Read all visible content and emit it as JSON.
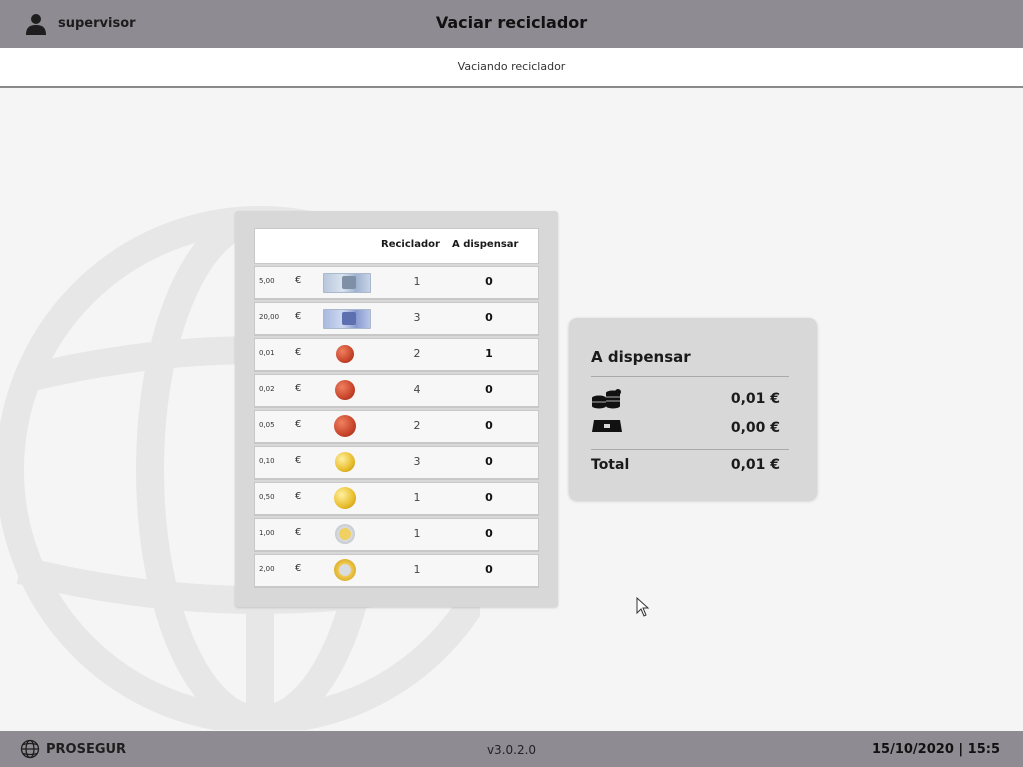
{
  "header": {
    "user": "supervisor",
    "title": "Vaciar reciclador",
    "subtitle": "Vaciando reciclador"
  },
  "table": {
    "col_recycler": "Reciclador",
    "col_dispense": "A dispensar",
    "rows": [
      {
        "denom": "5,00",
        "currency": "€",
        "type": "banknote-5-icon",
        "recycler": "1",
        "dispense": "0"
      },
      {
        "denom": "20,00",
        "currency": "€",
        "type": "banknote-20-icon",
        "recycler": "3",
        "dispense": "0"
      },
      {
        "denom": "0,01",
        "currency": "€",
        "type": "coin-copper-icon",
        "recycler": "2",
        "dispense": "1"
      },
      {
        "denom": "0,02",
        "currency": "€",
        "type": "coin-copper-icon",
        "recycler": "4",
        "dispense": "0"
      },
      {
        "denom": "0,05",
        "currency": "€",
        "type": "coin-copper-icon",
        "recycler": "2",
        "dispense": "0"
      },
      {
        "denom": "0,10",
        "currency": "€",
        "type": "coin-gold-icon",
        "recycler": "3",
        "dispense": "0"
      },
      {
        "denom": "0,50",
        "currency": "€",
        "type": "coin-gold-icon",
        "recycler": "1",
        "dispense": "0"
      },
      {
        "denom": "1,00",
        "currency": "€",
        "type": "coin-bimetal-icon",
        "recycler": "1",
        "dispense": "0"
      },
      {
        "denom": "2,00",
        "currency": "€",
        "type": "coin-bimetal-icon",
        "recycler": "1",
        "dispense": "0"
      }
    ]
  },
  "summary": {
    "title": "A dispensar",
    "coins_value": "0,01 €",
    "notes_value": "0,00 €",
    "total_label": "Total",
    "total_value": "0,01 €"
  },
  "footer": {
    "brand": "PROSEGUR",
    "version": "v3.0.2.0",
    "datetime": "15/10/2020 | 15:5"
  },
  "colors": {
    "bar": "#8e8b92",
    "panel": "#d8d8d8",
    "background": "#f5f5f5"
  }
}
